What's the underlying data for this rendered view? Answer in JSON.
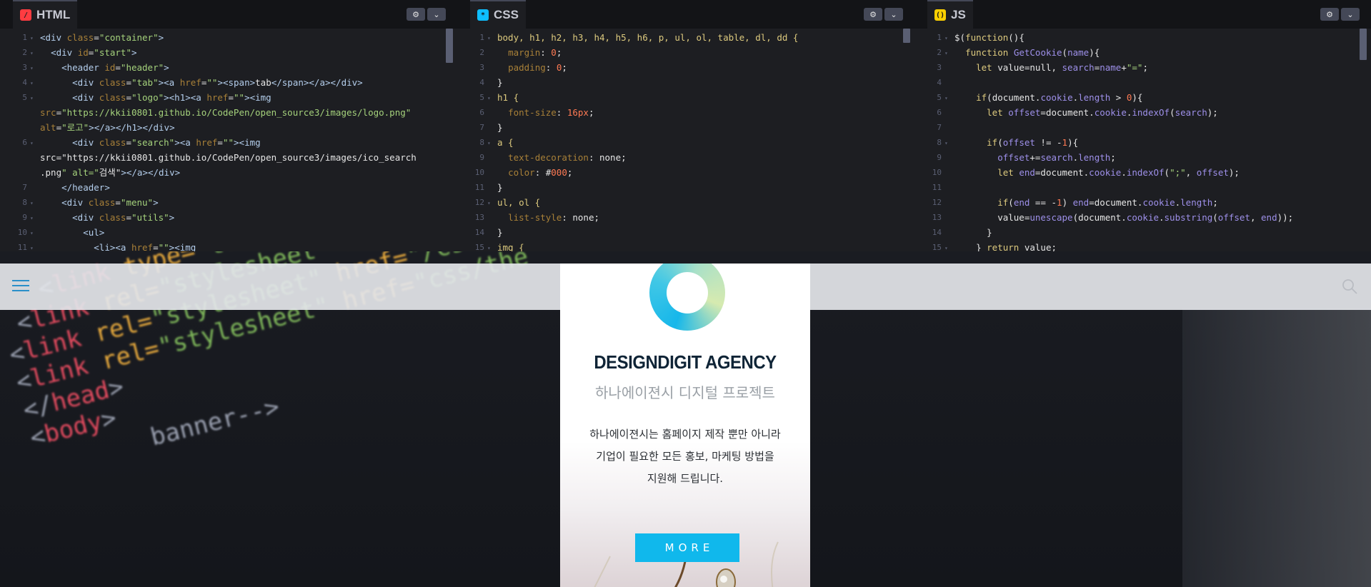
{
  "panels": [
    {
      "name": "HTML",
      "badge": "/",
      "badge_color": "#ff3c41"
    },
    {
      "name": "CSS",
      "badge": "*",
      "badge_color": "#0ebeff"
    },
    {
      "name": "JS",
      "badge": "()",
      "badge_color": "#fcd000"
    }
  ],
  "settings_icon": "gear-icon",
  "dropdown_icon": "chevron-down-icon",
  "html_code": [
    "<div class=\"container\">",
    "  <div id=\"start\">",
    "    <header id=\"header\">",
    "      <div class=\"tab\"><a href=\"\"><span>tab</span></a></div>",
    "      <div class=\"logo\"><h1><a href=\"\"><img",
    "src=\"https://kkii0801.github.io/CodePen/open_source3/images/logo.png\"",
    "alt=\"로고\"></a></h1></div>",
    "      <div class=\"search\"><a href=\"\"><img",
    "src=\"https://kkii0801.github.io/CodePen/open_source3/images/ico_search",
    ".png\" alt=\"검색\"></a></div>",
    "    </header>",
    "    <div class=\"menu\">",
    "      <div class=\"utils\">",
    "        <ul>",
    "          <li><a href=\"\"><img"
  ],
  "html_line_numbers": [
    "1",
    "2",
    "3",
    "4",
    "5",
    "",
    "",
    "6",
    "",
    "",
    "7",
    "8",
    "9",
    "10",
    "11"
  ],
  "css_code": [
    "body, h1, h2, h3, h4, h5, h6, p, ul, ol, table, dl, dd {",
    "  margin: 0;",
    "  padding: 0;",
    "}",
    "h1 {",
    "  font-size: 16px;",
    "}",
    "a {",
    "  text-decoration: none;",
    "  color: #000;",
    "}",
    "ul, ol {",
    "  list-style: none;",
    "}",
    "img {"
  ],
  "js_code": [
    "$(function(){",
    "  function GetCookie(name){",
    "    let value=null, search=name+\"=\";",
    "",
    "    if(document.cookie.length > 0){",
    "      let offset=document.cookie.indexOf(search);",
    "",
    "      if(offset != -1){",
    "        offset+=search.length;",
    "        let end=document.cookie.indexOf(\";\", offset);",
    "",
    "        if(end == -1) end=document.cookie.length;",
    "        value=unescape(document.cookie.substring(offset, end));",
    "      }",
    "    } return value;"
  ],
  "preview": {
    "menu_icon": "hamburger-menu-icon",
    "search_icon": "search-icon",
    "logo_icon": "ring-logo-icon",
    "title": "DESIGNDIGIT AGENCY",
    "subtitle": "하나에이젼시 디지털 프로젝트",
    "description_lines": [
      "하나에이젼시는 홈페이지 제작 뿐만 아니라",
      "기업이 필요한 모든 홍보, 마케팅 방법을",
      "지원해 드립니다."
    ],
    "more_button": "MORE",
    "button_color": "#10b8ec"
  }
}
